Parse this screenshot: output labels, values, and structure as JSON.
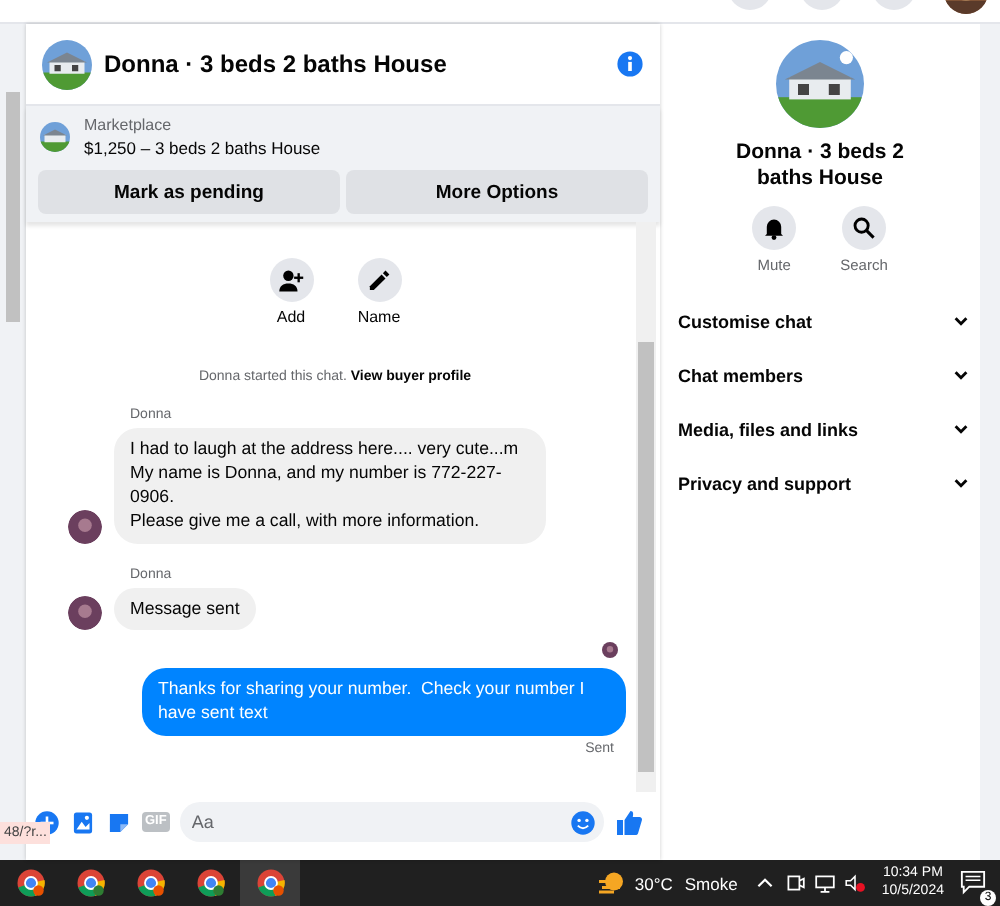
{
  "chat": {
    "title": "Donna · 3 beds 2 baths House",
    "marketplace": {
      "label": "Marketplace",
      "listing": "$1,250 – 3 beds 2 baths House"
    },
    "buttons": [
      "Mark as pending",
      "More Options"
    ],
    "actions": [
      {
        "kind": "add",
        "label": "Add"
      },
      {
        "kind": "name",
        "label": "Name"
      }
    ],
    "started": {
      "text": "Donna started this chat.",
      "link": "View buyer profile"
    },
    "messages": [
      {
        "kind": "incoming",
        "sender": "Donna",
        "text": "I had to laugh at the address here.... very cute...m\nMy name is Donna, and my number is 772-227-0906.\nPlease give me a call, with more information."
      },
      {
        "kind": "incoming",
        "sender": "Donna",
        "text": "Message sent"
      },
      {
        "kind": "outgoing",
        "text": "Thanks for sharing your number.  Check your number I have sent text",
        "status": "Sent"
      }
    ],
    "composer": {
      "gif": "GIF",
      "placeholder": "Aa"
    }
  },
  "status_tooltip": "48/?r...",
  "details": {
    "title": "Donna · 3 beds 2 baths House",
    "actions": [
      {
        "kind": "mute",
        "label": "Mute"
      },
      {
        "kind": "search",
        "label": "Search"
      }
    ],
    "sections": [
      {
        "label": "Customise chat",
        "expanded": false
      },
      {
        "label": "Chat members",
        "expanded": false
      },
      {
        "label": "Media, files and links",
        "expanded": false
      },
      {
        "label": "Privacy and support",
        "expanded": false
      }
    ]
  },
  "taskbar": {
    "apps": [
      {
        "selected": false
      },
      {
        "selected": false
      },
      {
        "selected": false
      },
      {
        "selected": false
      },
      {
        "selected": true
      }
    ],
    "weather": {
      "temp": "30°C",
      "condition": "Smoke"
    },
    "time": "10:34 PM",
    "date": "10/5/2024",
    "notifications": "3"
  }
}
